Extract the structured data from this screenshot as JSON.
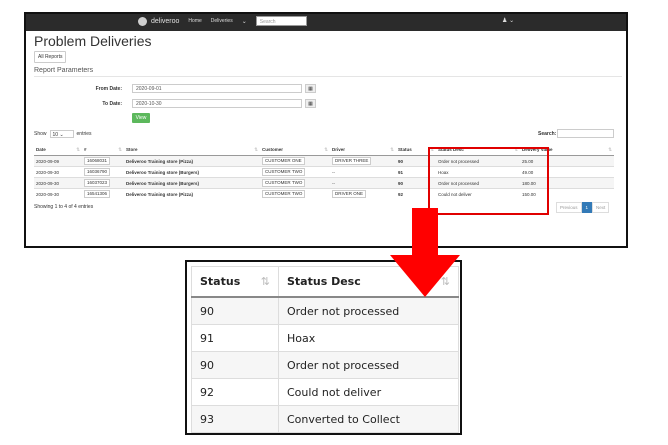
{
  "navbar": {
    "brand": "deliveroo",
    "links": [
      "Home",
      "Deliveries"
    ],
    "search_placeholder": "Search",
    "user_icon": "user-icon"
  },
  "page": {
    "title": "Problem Deliveries",
    "all_reports": "All Reports",
    "section_title": "Report Parameters",
    "from_label": "From Date:",
    "from_value": "2020-09-01",
    "to_label": "To Date:",
    "to_value": "2020-10-30",
    "view_button": "View"
  },
  "table_controls": {
    "show_label": "Show",
    "show_value": "10",
    "entries_label": "entries",
    "search_label": "Search:"
  },
  "table": {
    "headers": [
      "Date",
      "#",
      "Store",
      "Customer",
      "Driver",
      "Status",
      "Status Desc",
      "Delivery Value"
    ],
    "rows": [
      [
        "2020-09-09",
        "16068031",
        "Deliveroo Training store (Pizza)",
        "CUSTOMER ONE",
        "DRIVER THREE",
        "90",
        "Order not processed",
        "25.00"
      ],
      [
        "2020-09-30",
        "16036790",
        "Deliveroo Training store (Burgers)",
        "CUSTOMER TWO",
        "--",
        "91",
        "Hoax",
        "49.00"
      ],
      [
        "2020-09-30",
        "16037023",
        "Deliveroo Training store (Burgers)",
        "CUSTOMER TWO",
        "--",
        "90",
        "Order not processed",
        "180.00"
      ],
      [
        "2020-09-30",
        "16541306",
        "Deliveroo Training store (Pizza)",
        "CUSTOMER TWO",
        "DRIVER ONE",
        "92",
        "Could not deliver",
        "150.00"
      ]
    ],
    "info": "Showing 1 to 4 of 4 entries",
    "pager": [
      "Previous",
      "1",
      "Next"
    ]
  },
  "zoom": {
    "headers": [
      "Status",
      "Status Desc"
    ],
    "rows": [
      [
        "90",
        "Order not processed"
      ],
      [
        "91",
        "Hoax"
      ],
      [
        "90",
        "Order not processed"
      ],
      [
        "92",
        "Could not deliver"
      ],
      [
        "93",
        "Converted to Collect"
      ]
    ]
  },
  "colors": {
    "highlight": "#e00000",
    "arrow": "#ff0000",
    "navbar": "#2b2b2b",
    "view_button": "#5cb85c"
  }
}
